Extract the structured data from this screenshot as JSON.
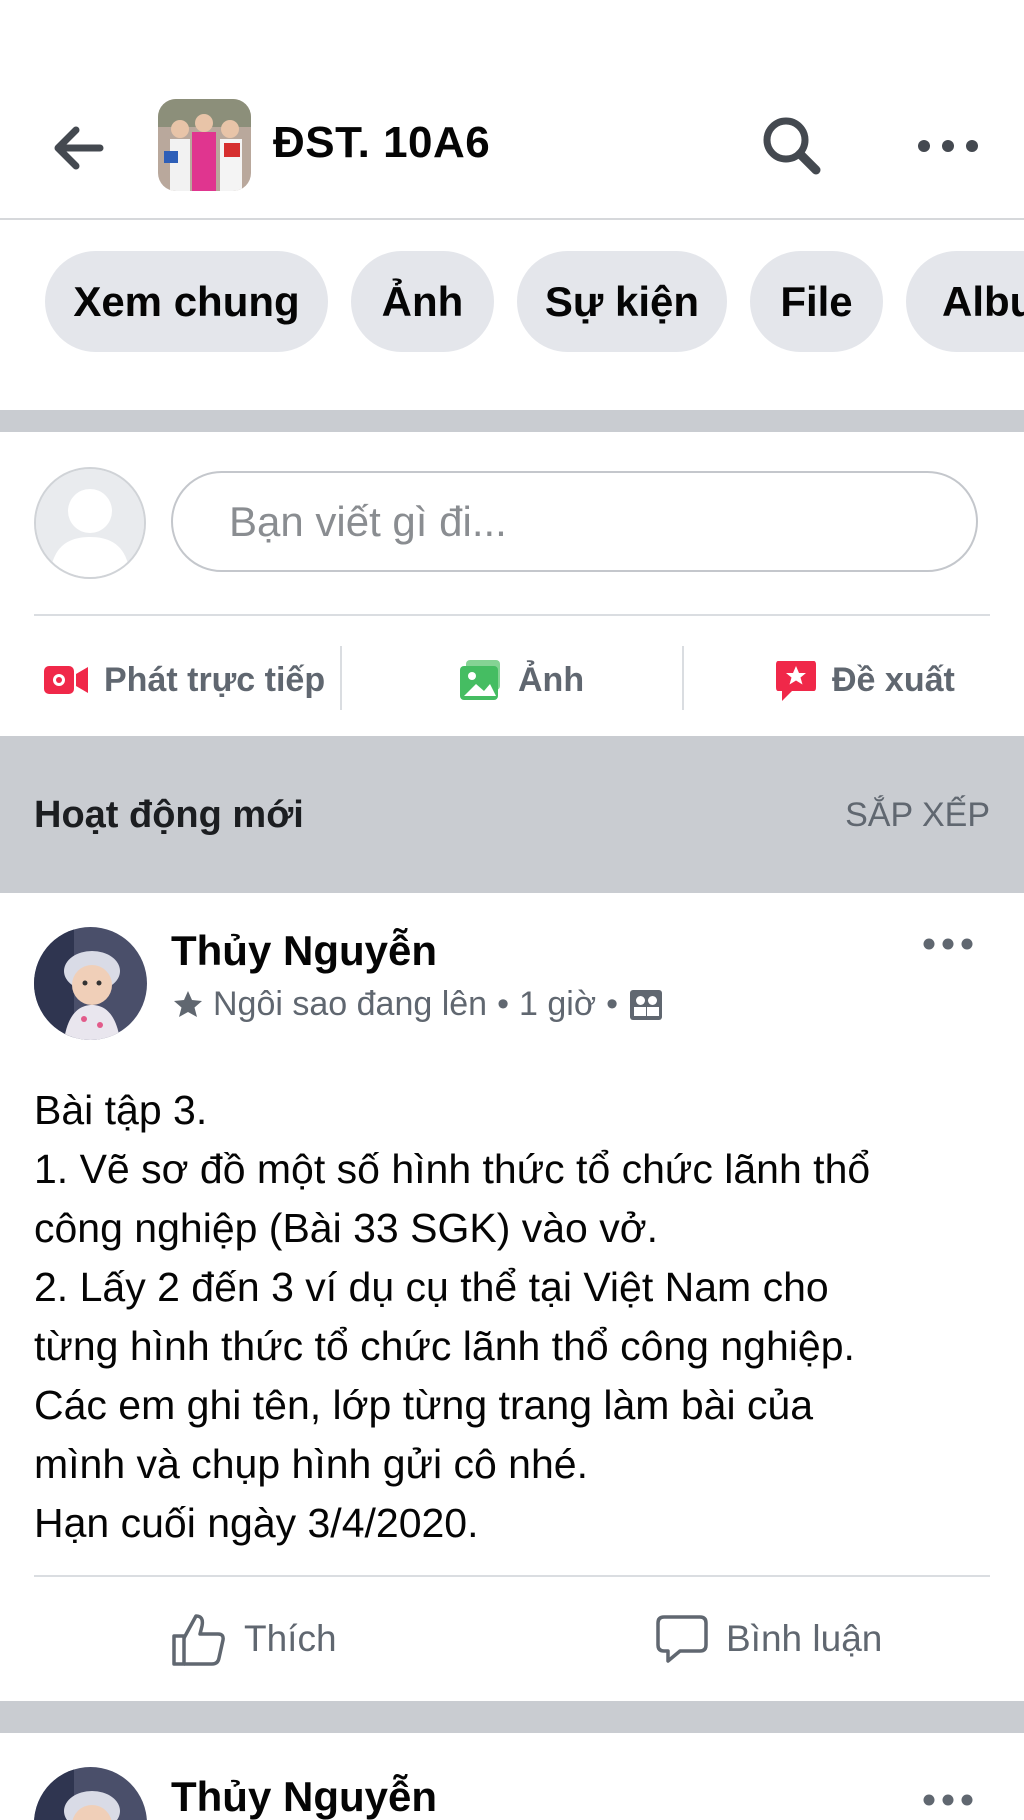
{
  "header": {
    "title": "ĐST. 10A6",
    "back_icon": "arrow-left-icon",
    "search_icon": "search-icon",
    "more_icon": "more-horizontal-icon"
  },
  "tabs": [
    {
      "label": "Xem chung"
    },
    {
      "label": "Ảnh"
    },
    {
      "label": "Sự kiện"
    },
    {
      "label": "File"
    },
    {
      "label": "Album"
    }
  ],
  "composer": {
    "placeholder": "Bạn viết gì đi...",
    "actions": [
      {
        "label": "Phát trực tiếp",
        "icon": "live-video-icon",
        "color": "#f02849"
      },
      {
        "label": "Ảnh",
        "icon": "photo-icon",
        "color": "#45bd62"
      },
      {
        "label": "Đề xuất",
        "icon": "recommend-icon",
        "color": "#f02849"
      }
    ]
  },
  "feed": {
    "section_title": "Hoạt động mới",
    "sort_label": "SẮP XẾP"
  },
  "posts": [
    {
      "author": "Thủy Nguyễn",
      "badge": "Ngôi sao đang lên",
      "time": "1 giờ",
      "lines": [
        "Bài tập 3.",
        "1. Vẽ sơ đồ một số hình thức tổ chức lãnh thổ",
        "công nghiệp (Bài 33 SGK) vào vở.",
        "2. Lấy 2 đến 3 ví dụ cụ thể tại Việt Nam cho",
        "từng hình thức tổ chức lãnh thổ công nghiệp.",
        "Các em ghi tên, lớp từng trang làm bài của",
        "mình và chụp hình gửi cô nhé.",
        "Hạn cuối ngày 3/4/2020."
      ],
      "like_label": "Thích",
      "comment_label": "Bình luận"
    },
    {
      "author": "Thủy Nguyễn"
    }
  ],
  "colors": {
    "separator": "#c9ccd1",
    "pill": "#e4e6eb",
    "secondary_text": "#606770"
  }
}
